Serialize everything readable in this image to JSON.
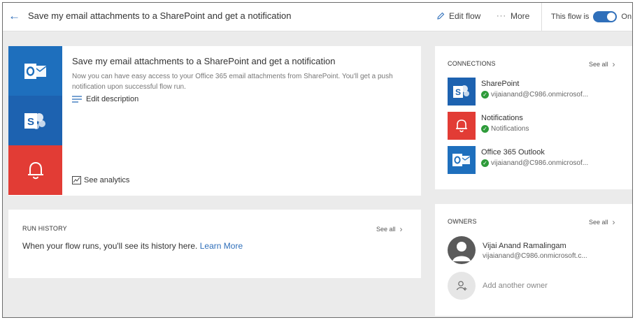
{
  "header": {
    "back_icon": "arrow-left-icon",
    "title": "Save my email attachments to a SharePoint and get a notification",
    "edit_flow": "Edit flow",
    "more": "More",
    "flow_is": "This flow is",
    "toggle_state": "On"
  },
  "details": {
    "title": "Save my email attachments to a SharePoint and get a notification",
    "description": "Now you can have easy access to your Office 365 email attachments from SharePoint. You'll get a push notification upon successful flow run.",
    "edit_description": "Edit description",
    "see_analytics": "See analytics"
  },
  "run_history": {
    "heading": "RUN HISTORY",
    "see_all": "See all",
    "message": "When your flow runs, you'll see its history here.",
    "learn_more": "Learn More"
  },
  "connections": {
    "heading": "CONNECTIONS",
    "see_all": "See all",
    "items": [
      {
        "name": "SharePoint",
        "account": "vijaianand@C986.onmicrosof...",
        "icon": "sharepoint-icon",
        "color": "#1d62b0"
      },
      {
        "name": "Notifications",
        "account": "Notifications",
        "icon": "bell-icon",
        "color": "#e23c35"
      },
      {
        "name": "Office 365 Outlook",
        "account": "vijaianand@C986.onmicrosof...",
        "icon": "outlook-icon",
        "color": "#1e6fbd"
      }
    ]
  },
  "owners": {
    "heading": "OWNERS",
    "see_all": "See all",
    "owner_name": "Vijai Anand Ramalingam",
    "owner_email": "vijaianand@C986.onmicrosoft.c...",
    "add_owner": "Add another owner"
  },
  "colors": {
    "accent": "#2f6fba",
    "outlook": "#1e6fbd",
    "sharepoint": "#1d62b0",
    "notification": "#e23c35",
    "success": "#2e9b3a"
  }
}
